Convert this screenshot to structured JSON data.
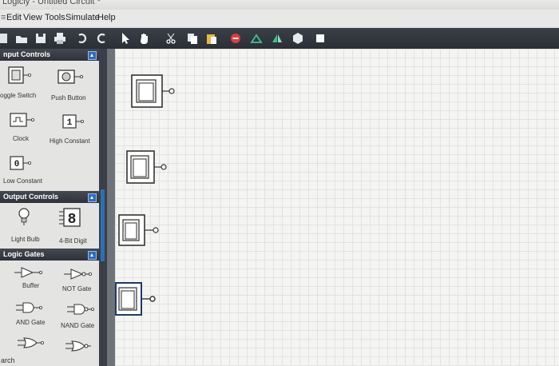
{
  "window": {
    "title": "Logicly - Untitled Circuit *"
  },
  "menu": [
    "Edit",
    "View",
    "Tools",
    "Simulate",
    "Help"
  ],
  "toolbar": {
    "icons": [
      "new-icon",
      "open-icon",
      "save-icon",
      "print-icon",
      "undo-icon",
      "redo-icon",
      "pointer-icon",
      "hand-icon",
      "cut-icon",
      "copy-icon",
      "paste-icon",
      "delete-icon",
      "align-icon",
      "flip-icon",
      "settings-icon",
      "chip-icon"
    ]
  },
  "sidebar": {
    "input_controls": {
      "header": "nput Controls",
      "items": [
        {
          "label": "oggle Switch",
          "icon": "toggle-switch-icon"
        },
        {
          "label": "Push Button",
          "icon": "push-button-icon"
        },
        {
          "label": "Clock",
          "icon": "clock-icon"
        },
        {
          "label": "High Constant",
          "icon": "high-constant-icon",
          "glyph": "1"
        },
        {
          "label": "Low Constant",
          "icon": "low-constant-icon",
          "glyph": "0"
        }
      ]
    },
    "output_controls": {
      "header": "Output Controls",
      "items": [
        {
          "label": "Light Bulb",
          "icon": "light-bulb-icon"
        },
        {
          "label": "4-Bit Digit",
          "icon": "four-bit-digit-icon",
          "glyph": "8"
        }
      ]
    },
    "logic_gates": {
      "header": "Logic Gates",
      "items": [
        {
          "label": "Buffer",
          "icon": "buffer-gate-icon"
        },
        {
          "label": "NOT Gate",
          "icon": "not-gate-icon"
        },
        {
          "label": "AND Gate",
          "icon": "and-gate-icon"
        },
        {
          "label": "NAND Gate",
          "icon": "nand-gate-icon"
        }
      ]
    },
    "search_label": "arch"
  },
  "canvas": {
    "components": [
      "toggle-switch",
      "toggle-switch",
      "toggle-switch",
      "toggle-switch"
    ]
  },
  "colors": {
    "toolbar": "#2f333a",
    "accent": "#2b6cc4",
    "canvas": "#f4f4f2",
    "grid": "#e2e2e0"
  }
}
